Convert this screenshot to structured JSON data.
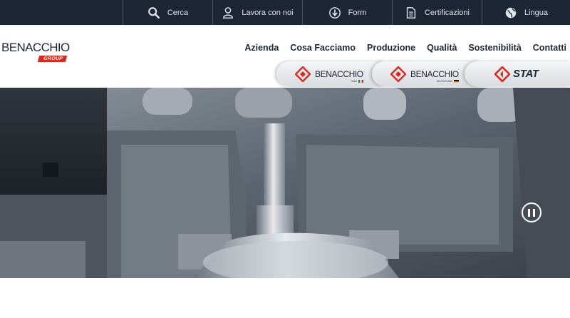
{
  "topbar": {
    "items": [
      {
        "label": "Cerca",
        "icon": "search-icon"
      },
      {
        "label": "Lavora con noi",
        "icon": "user-icon"
      },
      {
        "label": "Form",
        "icon": "download-circle-icon"
      },
      {
        "label": "Certificazioni",
        "icon": "document-icon"
      },
      {
        "label": "Lingua",
        "icon": "globe-icon"
      }
    ]
  },
  "logo": {
    "word": "BENACCHIO",
    "badge": "GROUP",
    "brand_color": "#d52b1e"
  },
  "nav": {
    "items": [
      "Azienda",
      "Cosa Facciamo",
      "Produzione",
      "Qualità",
      "Sostenibilità",
      "Contatti"
    ]
  },
  "brands": {
    "italia": {
      "name": "BENACCHIO",
      "sub": "ITALIA"
    },
    "deutschland": {
      "name": "BENACCHIO",
      "sub": "DEUTSCHLAND"
    },
    "stat": {
      "name": "STAT"
    }
  },
  "colors": {
    "topbar": "#1d2635",
    "accent": "#d52b1e"
  }
}
